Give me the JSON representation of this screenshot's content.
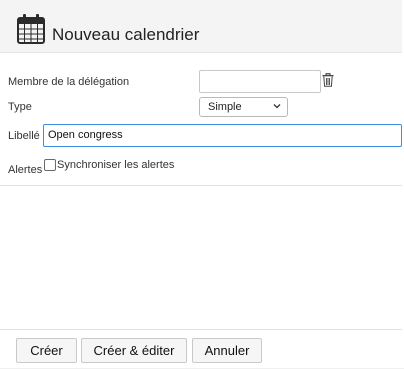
{
  "dialog": {
    "title": "Nouveau calendrier",
    "title_icon": "calendar-icon"
  },
  "form": {
    "delegation": {
      "label": "Membre de la délégation",
      "value": "",
      "clear_icon": "trash-icon"
    },
    "type": {
      "label": "Type",
      "value": "Simple",
      "icon": "chevron-down-icon"
    },
    "libelle": {
      "label": "Libellé",
      "value": "Open congress"
    },
    "alertes": {
      "label": "Alertes",
      "checkbox_label": "Synchroniser les alertes",
      "checked": false
    }
  },
  "buttons": {
    "create": "Créer",
    "create_edit": "Créer & éditer",
    "cancel": "Annuler"
  },
  "colors": {
    "header_bg": "#f4f4f4",
    "focus_border": "#3d8ee3",
    "button_bg": "#f6f6f6"
  }
}
